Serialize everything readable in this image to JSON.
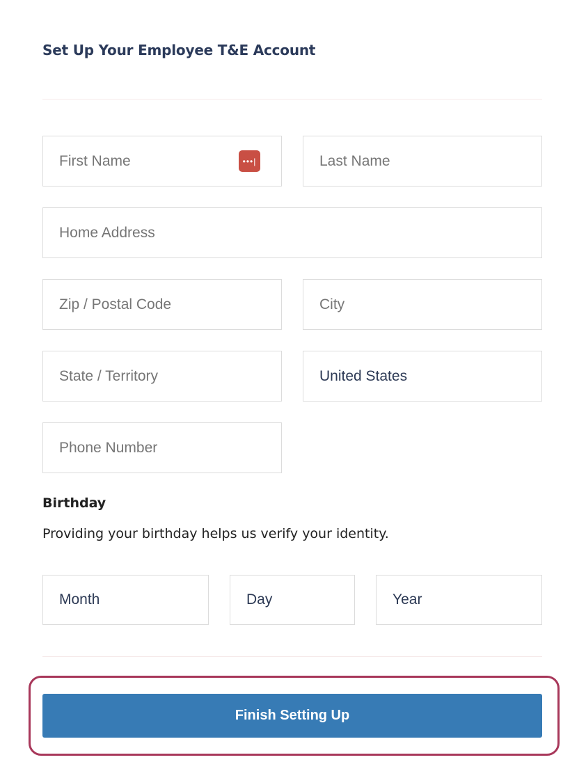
{
  "title": "Set Up Your Employee T&E Account",
  "fields": {
    "first_name": {
      "placeholder": "First Name",
      "password_manager_icon": "password-dots-icon"
    },
    "last_name": {
      "placeholder": "Last Name"
    },
    "home_address": {
      "placeholder": "Home Address"
    },
    "zip": {
      "placeholder": "Zip / Postal Code"
    },
    "city": {
      "placeholder": "City"
    },
    "state": {
      "placeholder": "State / Territory"
    },
    "country": {
      "value": "United States"
    },
    "phone": {
      "placeholder": "Phone Number"
    }
  },
  "birthday": {
    "label": "Birthday",
    "help": "Providing your birthday helps us verify your identity.",
    "month": "Month",
    "day": "Day",
    "year": "Year"
  },
  "submit": {
    "label": "Finish Setting Up"
  },
  "colors": {
    "button": "#377bb5",
    "highlight": "#a8375a",
    "title": "#2b3a5a"
  }
}
